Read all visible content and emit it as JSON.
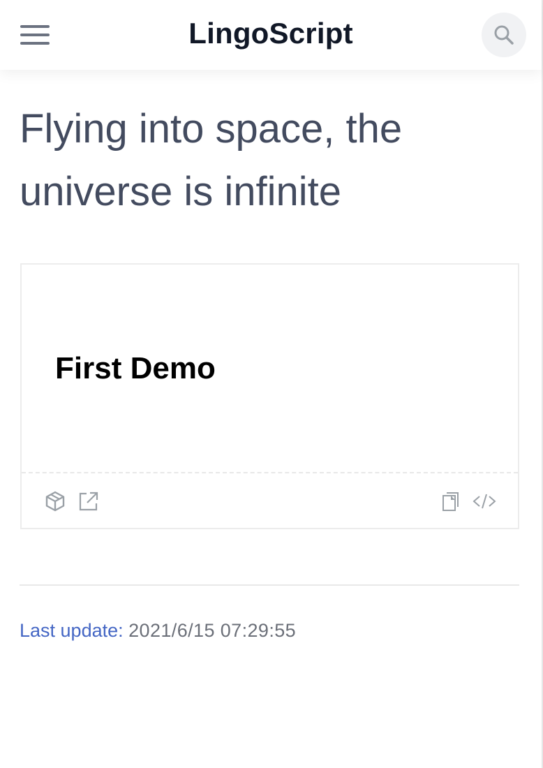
{
  "header": {
    "brand": "LingoScript",
    "menu_icon": "hamburger-menu-icon",
    "search_icon": "search-icon"
  },
  "page": {
    "title": "Flying into space, the universe is infinite"
  },
  "demo": {
    "heading": "First Demo",
    "actions": {
      "codesandbox_icon": "cube-icon",
      "open_icon": "external-link-icon",
      "copy_icon": "copy-icon",
      "code_icon": "code-icon"
    }
  },
  "footer": {
    "last_update_label": "Last update:",
    "last_update_value": "2021/6/15 07:29:55"
  },
  "colors": {
    "title": "#434b5f",
    "brand": "#111827",
    "link": "#4466c4",
    "icon": "#9aa0a6"
  }
}
